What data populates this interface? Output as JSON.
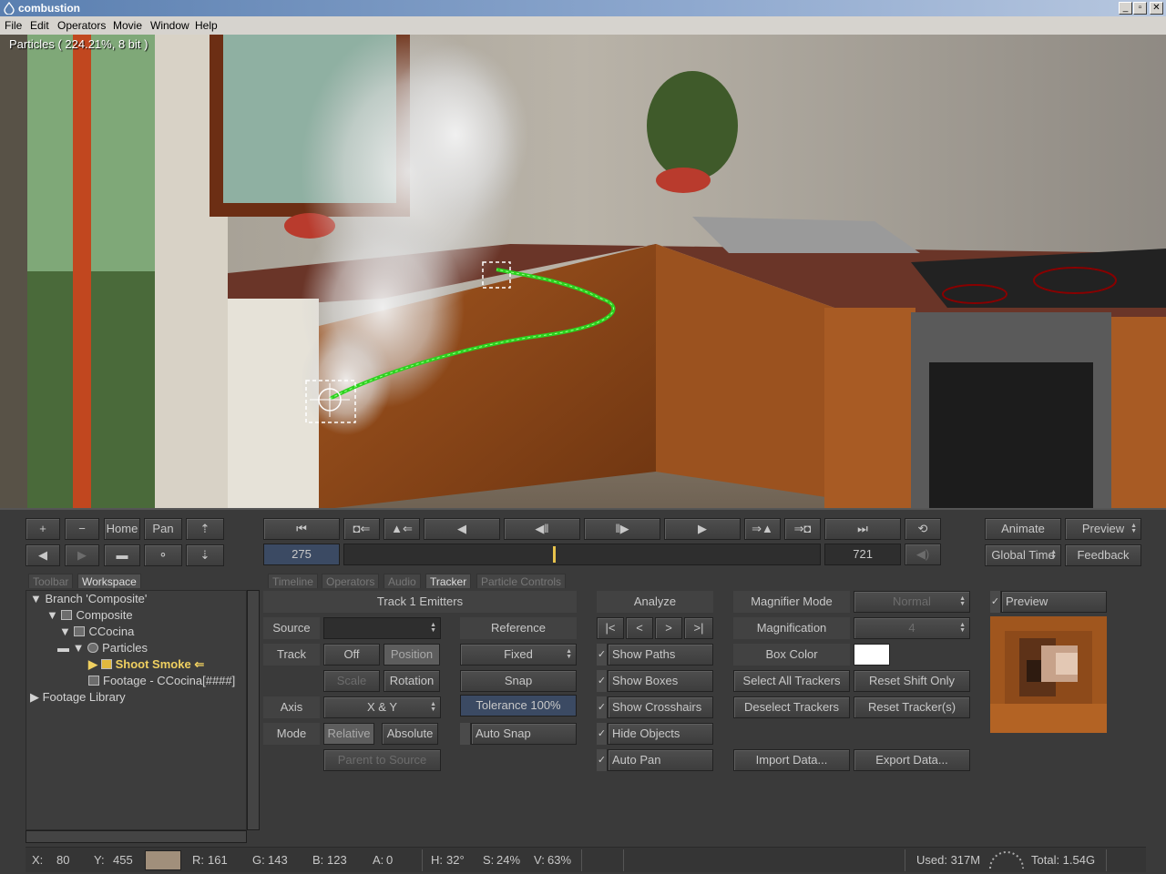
{
  "window": {
    "title": "combustion",
    "buttons": [
      "_",
      "▫",
      "✕"
    ]
  },
  "menu": [
    "File",
    "Edit",
    "Operators",
    "Movie",
    "Window",
    "Help"
  ],
  "viewport": {
    "label": "Particles ( 224.21%, 8 bit )"
  },
  "nav": {
    "plus": "+",
    "minus": "−",
    "home": "Home",
    "pan": "Pan"
  },
  "transport": {
    "current_frame": "275",
    "end_frame": "721",
    "playhead_fraction": 0.44
  },
  "right_top": {
    "animate": "Animate",
    "preview": "Preview",
    "global_time": "Global Time",
    "feedback": "Feedback"
  },
  "left_tabs": [
    "Toolbar",
    "Workspace"
  ],
  "main_tabs": [
    "Timeline",
    "Operators",
    "Audio",
    "Tracker",
    "Particle Controls"
  ],
  "tree": [
    "Branch 'Composite'",
    "Composite",
    "CCocina",
    "Particles",
    "Shoot Smoke",
    "Footage - CCocina[####]",
    "Footage Library"
  ],
  "tracker": {
    "header": "Track 1 Emitters",
    "source_label": "Source",
    "track_label": "Track",
    "off": "Off",
    "position": "Position",
    "scale": "Scale",
    "rotation": "Rotation",
    "axis_label": "Axis",
    "axis_value": "X & Y",
    "mode_label": "Mode",
    "relative": "Relative",
    "absolute": "Absolute",
    "parent_to_source": "Parent to Source",
    "reference": "Reference",
    "fixed": "Fixed",
    "snap": "Snap",
    "tolerance": "Tolerance 100%",
    "auto_snap": "Auto Snap"
  },
  "analyze": {
    "header": "Analyze",
    "show_paths": "Show Paths",
    "show_boxes": "Show Boxes",
    "show_crosshairs": "Show Crosshairs",
    "hide_objects": "Hide Objects",
    "auto_pan": "Auto Pan"
  },
  "magnifier": {
    "mode_label": "Magnifier Mode",
    "mode_value": "Normal",
    "magnification_label": "Magnification",
    "magnification_value": "4",
    "box_color_label": "Box Color",
    "box_color": "#ffffff",
    "select_all": "Select All Trackers",
    "reset_shift": "Reset Shift Only",
    "deselect": "Deselect Trackers",
    "reset_trackers": "Reset Tracker(s)",
    "import": "Import Data...",
    "export": "Export Data...",
    "preview": "Preview"
  },
  "status": {
    "x_label": "X:",
    "x": "80",
    "y_label": "Y:",
    "y": "455",
    "swatch": "#a18f7b",
    "r_label": "R:",
    "r": "161",
    "g_label": "G:",
    "g": "143",
    "b_label": "B:",
    "b": "123",
    "a_label": "A:",
    "a": "0",
    "h_label": "H:",
    "h": "32°",
    "s_label": "S:",
    "s": "24%",
    "v_label": "V:",
    "v": "63%",
    "used": "Used: 317M",
    "total": "Total: 1.54G"
  }
}
